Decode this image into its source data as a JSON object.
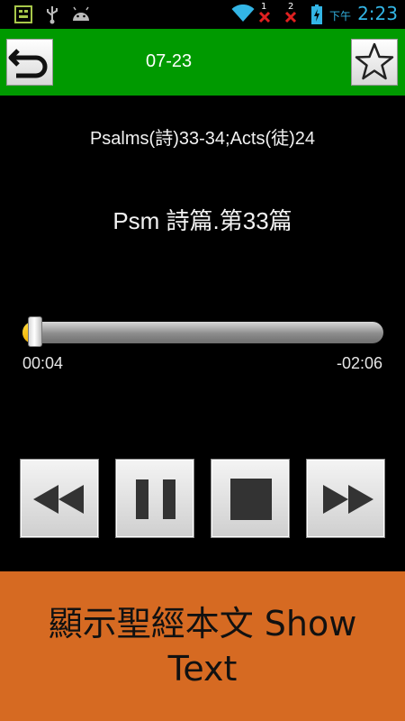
{
  "status_bar": {
    "ampm": "下午",
    "time": "2:23",
    "sim1_label": "1",
    "sim2_label": "2",
    "icons": [
      "app-icon",
      "usb-icon",
      "android-icon",
      "wifi-icon",
      "no-signal-icon",
      "no-signal-icon",
      "battery-charging-icon"
    ],
    "accent_color": "#33b5e5"
  },
  "header": {
    "title": "07-23",
    "back_icon": "back-arrow-icon",
    "favorite_icon": "star-icon",
    "background_color": "#009a00"
  },
  "reading": {
    "passage": "Psalms(詩)33-34;Acts(徒)24",
    "chapter": "Psm 詩篇.第33篇"
  },
  "player": {
    "progress_fraction": 0.03,
    "elapsed": "00:04",
    "remaining": "-02:06",
    "progress_color": "#f2b200",
    "controls": [
      "rewind-icon",
      "pause-icon",
      "stop-icon",
      "fast-forward-icon"
    ]
  },
  "show_text_button": {
    "label": "顯示聖經本文 Show Text",
    "background_color": "#d66a22"
  }
}
